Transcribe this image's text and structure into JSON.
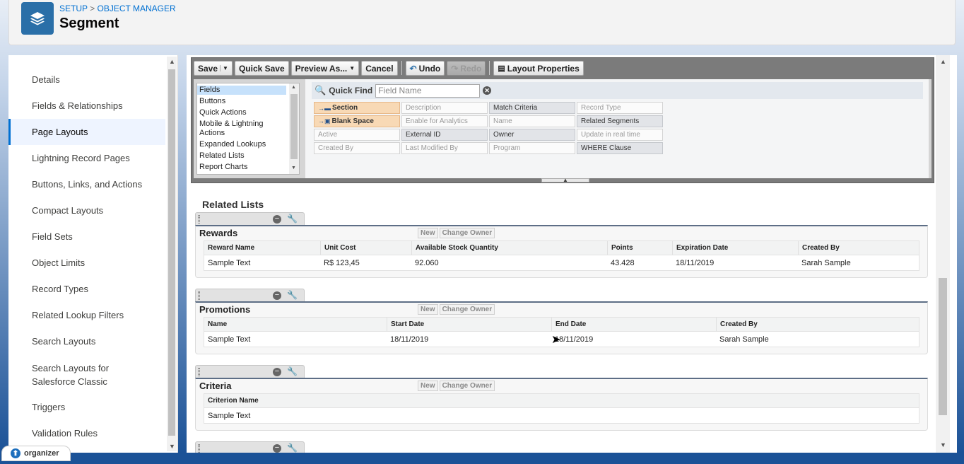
{
  "header": {
    "breadcrumb": [
      "SETUP",
      "OBJECT MANAGER"
    ],
    "breadcrumb_sep": ">",
    "title": "Segment"
  },
  "sidebar": {
    "items": [
      {
        "label": "Details"
      },
      {
        "label": "Fields & Relationships"
      },
      {
        "label": "Page Layouts",
        "active": true
      },
      {
        "label": "Lightning Record Pages"
      },
      {
        "label": "Buttons, Links, and Actions"
      },
      {
        "label": "Compact Layouts"
      },
      {
        "label": "Field Sets"
      },
      {
        "label": "Object Limits"
      },
      {
        "label": "Record Types"
      },
      {
        "label": "Related Lookup Filters"
      },
      {
        "label": "Search Layouts"
      },
      {
        "label": "Search Layouts for Salesforce Classic"
      },
      {
        "label": "Triggers"
      },
      {
        "label": "Validation Rules"
      }
    ]
  },
  "toolbar": {
    "save": "Save",
    "quick_save": "Quick Save",
    "preview_as": "Preview As...",
    "cancel": "Cancel",
    "undo": "Undo",
    "redo": "Redo",
    "layout_properties": "Layout Properties"
  },
  "palette": {
    "categories": [
      "Fields",
      "Buttons",
      "Quick Actions",
      "Mobile & Lightning Actions",
      "Expanded Lookups",
      "Related Lists",
      "Report Charts"
    ],
    "quick_find_label": "Quick Find",
    "quick_find_placeholder": "Field Name",
    "fields": [
      [
        "Section",
        "Description",
        "Match Criteria",
        "Record Type"
      ],
      [
        "Blank Space",
        "Enable for Analytics",
        "Name",
        "Related Segments"
      ],
      [
        "Active",
        "External ID",
        "Owner",
        "Update in real time"
      ],
      [
        "Created By",
        "Last Modified By",
        "Program",
        "WHERE Clause"
      ]
    ]
  },
  "related_lists": {
    "title": "Related Lists",
    "new_label": "New",
    "change_owner_label": "Change Owner",
    "lists": [
      {
        "name": "Rewards",
        "columns": [
          "Reward Name",
          "Unit Cost",
          "Available Stock Quantity",
          "Points",
          "Expiration Date",
          "Created By"
        ],
        "row": [
          "Sample Text",
          "R$ 123,45",
          "92.060",
          "43.428",
          "18/11/2019",
          "Sarah Sample"
        ]
      },
      {
        "name": "Promotions",
        "columns": [
          "Name",
          "Start Date",
          "End Date",
          "Created By"
        ],
        "row": [
          "Sample Text",
          "18/11/2019",
          "18/11/2019",
          "Sarah Sample"
        ]
      },
      {
        "name": "Criteria",
        "columns": [
          "Criterion Name"
        ],
        "row": [
          "Sample Text"
        ]
      }
    ]
  },
  "organizer": {
    "label": "organizer"
  }
}
